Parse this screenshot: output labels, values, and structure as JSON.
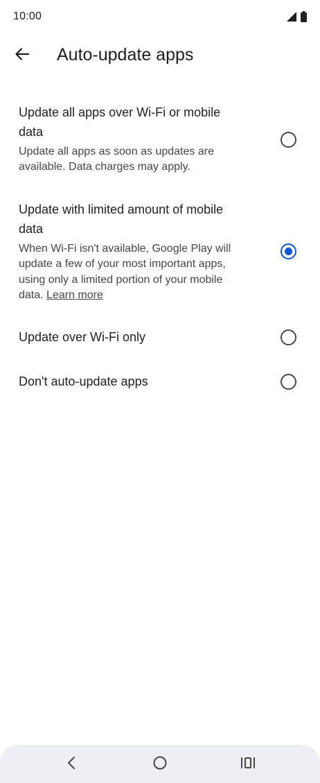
{
  "status_bar": {
    "time": "10:00",
    "icons": [
      "signal-icon",
      "battery-icon"
    ]
  },
  "app_bar": {
    "title": "Auto-update apps",
    "back_icon": "arrow-back-icon"
  },
  "options": [
    {
      "title": "Update all apps over Wi-Fi or mobile data",
      "description": "Update all apps as soon as updates are available. Data charges may apply.",
      "selected": false
    },
    {
      "title": "Update with limited amount of mobile data",
      "description": "When Wi-Fi isn't available, Google Play will update a few of your most important apps, using only a limited portion of your mobile data.",
      "link": "Learn more",
      "selected": true
    },
    {
      "title": "Update over Wi-Fi only",
      "selected": false
    },
    {
      "title": "Don't auto-update apps",
      "selected": false
    }
  ],
  "nav_bar": {
    "icons": [
      "nav-back-icon",
      "home-icon",
      "recents-icon"
    ]
  },
  "colors": {
    "accent": "#0b57d0",
    "text_primary": "#1f1f1f",
    "text_secondary": "#444746",
    "nav_background": "#eceff3"
  }
}
